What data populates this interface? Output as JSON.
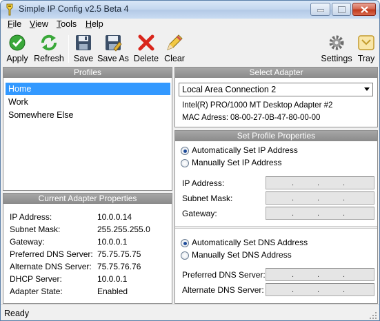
{
  "window": {
    "title": "Simple IP Config v2.5 Beta 4",
    "accent_close": "#c03a1c",
    "selection_color": "#3399ff"
  },
  "menu": [
    "File",
    "View",
    "Tools",
    "Help"
  ],
  "toolbar": {
    "apply": "Apply",
    "refresh": "Refresh",
    "save": "Save",
    "save_as": "Save As",
    "delete": "Delete",
    "clear": "Clear",
    "settings": "Settings",
    "tray": "Tray"
  },
  "profiles": {
    "header": "Profiles",
    "items": [
      "Home",
      "Work",
      "Somewhere Else"
    ],
    "selected": "Home"
  },
  "current": {
    "header": "Current Adapter Properties",
    "rows": [
      {
        "label": "IP Address:",
        "value": "10.0.0.14"
      },
      {
        "label": "Subnet Mask:",
        "value": "255.255.255.0"
      },
      {
        "label": "Gateway:",
        "value": "10.0.0.1"
      },
      {
        "label": "Preferred DNS Server:",
        "value": "75.75.75.75"
      },
      {
        "label": "Alternate DNS Server:",
        "value": "75.75.76.76"
      },
      {
        "label": "DHCP Server:",
        "value": "10.0.0.1"
      },
      {
        "label": "Adapter State:",
        "value": "Enabled"
      }
    ]
  },
  "adapter": {
    "header": "Select Adapter",
    "selected": "Local Area Connection 2",
    "description": "Intel(R) PRO/1000 MT Desktop Adapter #2",
    "mac_label": "MAC Adress:",
    "mac": "08-00-27-0B-47-80-00-00"
  },
  "profile_props": {
    "header": "Set Profile Properties",
    "auto_ip": "Automatically Set IP Address",
    "manual_ip": "Manually Set IP Address",
    "ip_label": "IP Address:",
    "subnet_label": "Subnet Mask:",
    "gateway_label": "Gateway:",
    "auto_dns": "Automatically Set DNS Address",
    "manual_dns": "Manually Set DNS Address",
    "pref_dns_label": "Preferred DNS Server:",
    "alt_dns_label": "Alternate DNS Server:"
  },
  "status": "Ready"
}
